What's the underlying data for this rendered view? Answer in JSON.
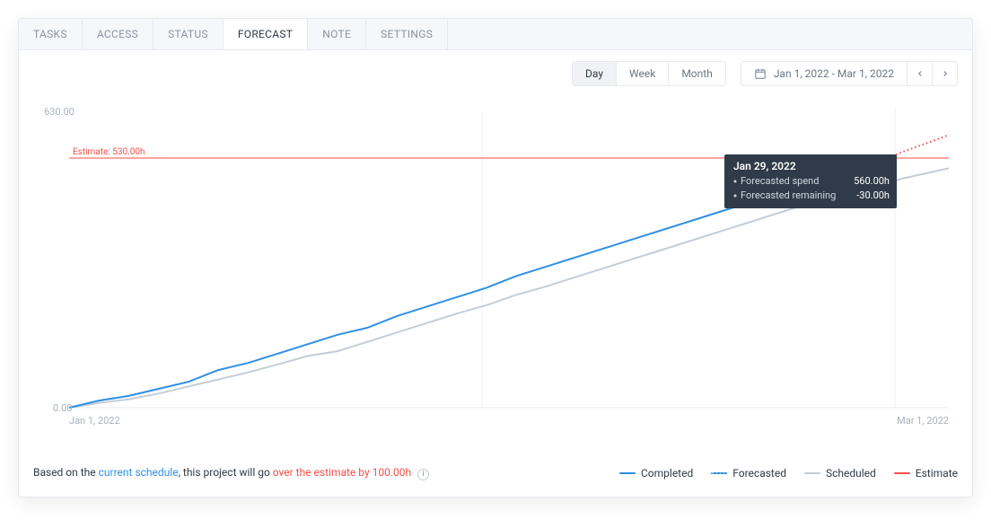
{
  "tabs": [
    {
      "label": "TASKS",
      "active": false
    },
    {
      "label": "ACCESS",
      "active": false
    },
    {
      "label": "STATUS",
      "active": false
    },
    {
      "label": "FORECAST",
      "active": true
    },
    {
      "label": "NOTE",
      "active": false
    },
    {
      "label": "SETTINGS",
      "active": false
    }
  ],
  "granularity": [
    {
      "label": "Day",
      "active": true
    },
    {
      "label": "Week",
      "active": false
    },
    {
      "label": "Month",
      "active": false
    }
  ],
  "daterange": {
    "label": "Jan 1, 2022 - Mar 1, 2022"
  },
  "axis": {
    "ymax_label": "630.00",
    "ymin_label": "0.00",
    "xstart_label": "Jan 1, 2022",
    "xend_label": "Mar 1, 2022"
  },
  "estimate_line_label": "Estimate: 530.00h",
  "tooltip": {
    "date": "Jan 29, 2022",
    "rows": [
      {
        "label": "Forecasted spend",
        "value": "560.00h"
      },
      {
        "label": "Forecasted remaining",
        "value": "-30.00h"
      }
    ]
  },
  "summary": {
    "prefix": "Based on the ",
    "link": "current schedule",
    "mid": ", this project will go ",
    "over": "over the estimate by 100.00h"
  },
  "legend": {
    "completed": "Completed",
    "forecasted": "Forecasted",
    "scheduled": "Scheduled",
    "estimate": "Estimate"
  },
  "colors": {
    "completed": "#2f8fe6",
    "scheduled": "#c5cdd6",
    "estimate": "#f44e4a",
    "grid": "#e5e9ee"
  },
  "chart_data": {
    "type": "line",
    "title": "Project hours forecast",
    "xlabel": "",
    "ylabel": "",
    "x_range": [
      "Jan 1, 2022",
      "Mar 1, 2022"
    ],
    "y_range": [
      0,
      630
    ],
    "estimate": 530,
    "series": [
      {
        "name": "Completed (h)",
        "x_days": [
          0,
          2,
          4,
          6,
          8,
          10,
          12,
          14,
          16,
          18,
          20,
          22,
          24,
          26,
          28,
          30,
          32,
          34,
          36,
          38,
          40,
          42,
          44,
          46,
          48,
          50,
          52
        ],
        "values": [
          0,
          15,
          25,
          40,
          55,
          80,
          95,
          115,
          135,
          155,
          170,
          195,
          215,
          235,
          255,
          280,
          300,
          320,
          340,
          360,
          380,
          400,
          420,
          440,
          460,
          478,
          489
        ]
      },
      {
        "name": "Scheduled (h)",
        "x_days": [
          0,
          2,
          4,
          6,
          8,
          10,
          12,
          14,
          16,
          18,
          20,
          22,
          24,
          26,
          28,
          30,
          32,
          34,
          36,
          38,
          40,
          42,
          44,
          46,
          48,
          50,
          52,
          54,
          56,
          59
        ],
        "values": [
          0,
          10,
          18,
          30,
          45,
          60,
          75,
          92,
          110,
          120,
          140,
          160,
          180,
          200,
          218,
          240,
          258,
          278,
          298,
          318,
          338,
          358,
          378,
          398,
          418,
          438,
          455,
          472,
          488,
          509
        ]
      },
      {
        "name": "Forecasted (h, dotted)",
        "x_days": [
          52,
          54,
          56,
          58,
          59
        ],
        "values": [
          489,
          520,
          545,
          568,
          580
        ]
      }
    ],
    "annotations": [
      {
        "type": "hline",
        "y": 530,
        "label": "Estimate: 530.00h"
      }
    ],
    "tooltip_sample": {
      "date": "Jan 29, 2022",
      "forecasted_spend_h": 560.0,
      "forecasted_remaining_h": -30.0
    }
  }
}
